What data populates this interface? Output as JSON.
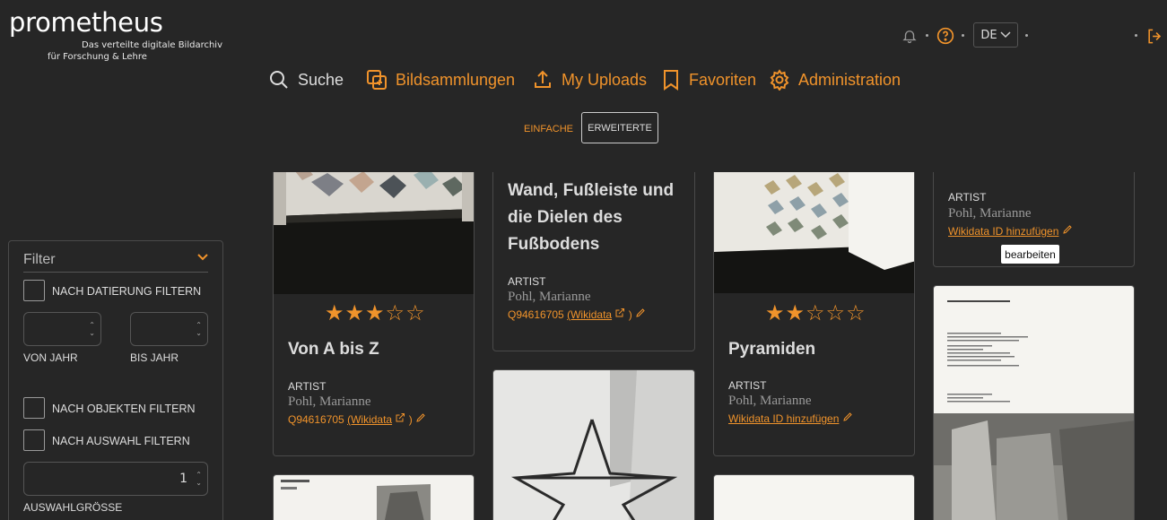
{
  "brand": {
    "title": "prometheus",
    "subtitle_line1": "Das verteilte digitale Bildarchiv",
    "subtitle_line2": "für Forschung & Lehre"
  },
  "topbar": {
    "language": "DE",
    "icons": [
      "bell-icon",
      "help-icon",
      "logout-icon"
    ]
  },
  "nav": {
    "search": "Suche",
    "collections": "Bildsammlungen",
    "uploads": "My Uploads",
    "favorites": "Favoriten",
    "admin": "Administration"
  },
  "search_tabs": {
    "simple": "EINFACHE",
    "extended": "ERWEITERTE"
  },
  "filter": {
    "title": "Filter",
    "by_date": "NACH DATIERUNG FILTERN",
    "from_year": "VON JAHR",
    "to_year": "BIS JAHR",
    "by_objects": "NACH OBJEKTEN FILTERN",
    "by_selection": "NACH AUSWAHL FILTERN",
    "selection_size_value": "1",
    "selection_size": "AUSWAHLGRÖSSE"
  },
  "cards": [
    {
      "title": "Von A bis Z",
      "label": "ARTIST",
      "artist": "Pohl, Marianne",
      "id": "Q94616705",
      "wiki": "(Wikidata",
      "rating": 3
    },
    {
      "title_lines": [
        "Wand, Fußleiste und",
        "die Dielen des",
        "Fußbodens"
      ],
      "label": "ARTIST",
      "artist": "Pohl, Marianne",
      "id": "Q94616705",
      "wiki": "(Wikidata"
    },
    {
      "title": "Pyramiden",
      "label": "ARTIST",
      "artist": "Pohl, Marianne",
      "wikidata_add": "Wikidata ID hinzufügen",
      "rating": 2
    },
    {
      "label": "ARTIST",
      "artist": "Pohl, Marianne",
      "wikidata_add": "Wikidata ID hinzufügen",
      "tooltip": "bearbeiten"
    }
  ],
  "colors": {
    "accent": "#f0932b",
    "background": "#262626",
    "border": "#4a4a4a"
  }
}
